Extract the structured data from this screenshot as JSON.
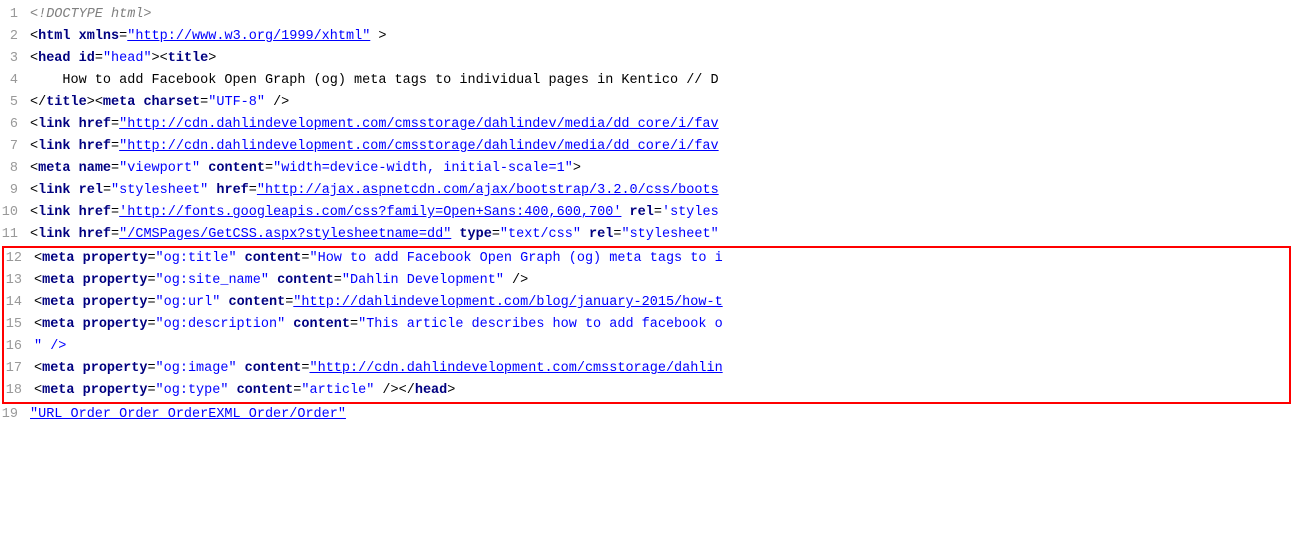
{
  "lines": [
    {
      "num": 1,
      "parts": [
        {
          "type": "comment",
          "text": "<!DOCTYPE html>"
        }
      ]
    },
    {
      "num": 2,
      "parts": [
        {
          "type": "punct",
          "text": "<"
        },
        {
          "type": "tag",
          "text": "html"
        },
        {
          "type": "punct",
          "text": " "
        },
        {
          "type": "attr-name",
          "text": "xmlns"
        },
        {
          "type": "punct",
          "text": "="
        },
        {
          "type": "attr-value",
          "text": "\"http://www.w3.org/1999/xhtml\""
        },
        {
          "type": "punct",
          "text": " >"
        }
      ]
    },
    {
      "num": 3,
      "parts": [
        {
          "type": "punct",
          "text": "<"
        },
        {
          "type": "tag",
          "text": "head"
        },
        {
          "type": "punct",
          "text": " "
        },
        {
          "type": "attr-name",
          "text": "id"
        },
        {
          "type": "punct",
          "text": "="
        },
        {
          "type": "attr-value-plain",
          "text": "\"head\""
        },
        {
          "type": "punct",
          "text": "><"
        },
        {
          "type": "tag",
          "text": "title"
        },
        {
          "type": "punct",
          "text": ">"
        }
      ]
    },
    {
      "num": 4,
      "parts": [
        {
          "type": "text-content",
          "text": "    How to add Facebook Open Graph (og) meta tags to individual pages in Kentico // D"
        }
      ]
    },
    {
      "num": 5,
      "parts": [
        {
          "type": "punct",
          "text": "</"
        },
        {
          "type": "tag",
          "text": "title"
        },
        {
          "type": "punct",
          "text": "><"
        },
        {
          "type": "tag",
          "text": "meta"
        },
        {
          "type": "punct",
          "text": " "
        },
        {
          "type": "attr-name",
          "text": "charset"
        },
        {
          "type": "punct",
          "text": "="
        },
        {
          "type": "attr-value-plain",
          "text": "\"UTF-8\""
        },
        {
          "type": "punct",
          "text": " />"
        }
      ]
    },
    {
      "num": 6,
      "parts": [
        {
          "type": "punct",
          "text": "<"
        },
        {
          "type": "tag",
          "text": "link"
        },
        {
          "type": "punct",
          "text": " "
        },
        {
          "type": "attr-name",
          "text": "href"
        },
        {
          "type": "punct",
          "text": "="
        },
        {
          "type": "attr-value",
          "text": "\"http://cdn.dahlindevelopment.com/cmsstorage/dahlindev/media/dd_core/i/fav"
        }
      ]
    },
    {
      "num": 7,
      "parts": [
        {
          "type": "punct",
          "text": "<"
        },
        {
          "type": "tag",
          "text": "link"
        },
        {
          "type": "punct",
          "text": " "
        },
        {
          "type": "attr-name",
          "text": "href"
        },
        {
          "type": "punct",
          "text": "="
        },
        {
          "type": "attr-value",
          "text": "\"http://cdn.dahlindevelopment.com/cmsstorage/dahlindev/media/dd_core/i/fav"
        }
      ]
    },
    {
      "num": 8,
      "parts": [
        {
          "type": "punct",
          "text": "<"
        },
        {
          "type": "tag",
          "text": "meta"
        },
        {
          "type": "punct",
          "text": " "
        },
        {
          "type": "attr-name",
          "text": "name"
        },
        {
          "type": "punct",
          "text": "="
        },
        {
          "type": "attr-value-plain",
          "text": "\"viewport\""
        },
        {
          "type": "punct",
          "text": " "
        },
        {
          "type": "attr-name",
          "text": "content"
        },
        {
          "type": "punct",
          "text": "="
        },
        {
          "type": "attr-value-plain",
          "text": "\"width=device-width, initial-scale=1\""
        },
        {
          "type": "punct",
          "text": ">"
        }
      ]
    },
    {
      "num": 9,
      "parts": [
        {
          "type": "punct",
          "text": "<"
        },
        {
          "type": "tag",
          "text": "link"
        },
        {
          "type": "punct",
          "text": " "
        },
        {
          "type": "attr-name",
          "text": "rel"
        },
        {
          "type": "punct",
          "text": "="
        },
        {
          "type": "attr-value-plain",
          "text": "\"stylesheet\""
        },
        {
          "type": "punct",
          "text": " "
        },
        {
          "type": "attr-name",
          "text": "href"
        },
        {
          "type": "punct",
          "text": "="
        },
        {
          "type": "attr-value",
          "text": "\"http://ajax.aspnetcdn.com/ajax/bootstrap/3.2.0/css/boots"
        }
      ]
    },
    {
      "num": 10,
      "parts": [
        {
          "type": "punct",
          "text": "<"
        },
        {
          "type": "tag",
          "text": "link"
        },
        {
          "type": "punct",
          "text": " "
        },
        {
          "type": "attr-name",
          "text": "href"
        },
        {
          "type": "punct",
          "text": "="
        },
        {
          "type": "attr-value",
          "text": "'http://fonts.googleapis.com/css?family=Open+Sans:400,600,700'"
        },
        {
          "type": "punct",
          "text": " "
        },
        {
          "type": "attr-name",
          "text": "rel"
        },
        {
          "type": "punct",
          "text": "="
        },
        {
          "type": "attr-value-plain",
          "text": "'styles"
        }
      ]
    },
    {
      "num": 11,
      "parts": [
        {
          "type": "punct",
          "text": "<"
        },
        {
          "type": "tag",
          "text": "link"
        },
        {
          "type": "punct",
          "text": " "
        },
        {
          "type": "attr-name",
          "text": "href"
        },
        {
          "type": "punct",
          "text": "="
        },
        {
          "type": "attr-value",
          "text": "\"/CMSPages/GetCSS.aspx?stylesheetname=dd\""
        },
        {
          "type": "punct",
          "text": " "
        },
        {
          "type": "attr-name",
          "text": "type"
        },
        {
          "type": "punct",
          "text": "="
        },
        {
          "type": "attr-value-plain",
          "text": "\"text/css\""
        },
        {
          "type": "punct",
          "text": " "
        },
        {
          "type": "attr-name",
          "text": "rel"
        },
        {
          "type": "punct",
          "text": "="
        },
        {
          "type": "attr-value-plain",
          "text": "\"stylesheet\""
        }
      ]
    },
    {
      "num": 12,
      "parts": [
        {
          "type": "punct",
          "text": "<"
        },
        {
          "type": "tag",
          "text": "meta"
        },
        {
          "type": "punct",
          "text": " "
        },
        {
          "type": "attr-name",
          "text": "property"
        },
        {
          "type": "punct",
          "text": "="
        },
        {
          "type": "attr-value-plain",
          "text": "\"og:title\""
        },
        {
          "type": "punct",
          "text": " "
        },
        {
          "type": "attr-name",
          "text": "content"
        },
        {
          "type": "punct",
          "text": "="
        },
        {
          "type": "attr-value-plain",
          "text": "\"How to add Facebook Open Graph (og) meta tags to i"
        }
      ],
      "highlighted": true
    },
    {
      "num": 13,
      "parts": [
        {
          "type": "punct",
          "text": "<"
        },
        {
          "type": "tag",
          "text": "meta"
        },
        {
          "type": "punct",
          "text": " "
        },
        {
          "type": "attr-name",
          "text": "property"
        },
        {
          "type": "punct",
          "text": "="
        },
        {
          "type": "attr-value-plain",
          "text": "\"og:site_name\""
        },
        {
          "type": "punct",
          "text": " "
        },
        {
          "type": "attr-name",
          "text": "content"
        },
        {
          "type": "punct",
          "text": "="
        },
        {
          "type": "attr-value-plain",
          "text": "\"Dahlin Development\""
        },
        {
          "type": "punct",
          "text": " />"
        }
      ],
      "highlighted": true
    },
    {
      "num": 14,
      "parts": [
        {
          "type": "punct",
          "text": "<"
        },
        {
          "type": "tag",
          "text": "meta"
        },
        {
          "type": "punct",
          "text": " "
        },
        {
          "type": "attr-name",
          "text": "property"
        },
        {
          "type": "punct",
          "text": "="
        },
        {
          "type": "attr-value-plain",
          "text": "\"og:url\""
        },
        {
          "type": "punct",
          "text": " "
        },
        {
          "type": "attr-name",
          "text": "content"
        },
        {
          "type": "punct",
          "text": "="
        },
        {
          "type": "attr-value",
          "text": "\"http://dahlindevelopment.com/blog/january-2015/how-t"
        }
      ],
      "highlighted": true
    },
    {
      "num": 15,
      "parts": [
        {
          "type": "punct",
          "text": "<"
        },
        {
          "type": "tag",
          "text": "meta"
        },
        {
          "type": "punct",
          "text": " "
        },
        {
          "type": "attr-name",
          "text": "property"
        },
        {
          "type": "punct",
          "text": "="
        },
        {
          "type": "attr-value-plain",
          "text": "\"og:description\""
        },
        {
          "type": "punct",
          "text": " "
        },
        {
          "type": "attr-name",
          "text": "content"
        },
        {
          "type": "punct",
          "text": "="
        },
        {
          "type": "attr-value-plain",
          "text": "\"This article describes how to add facebook o"
        }
      ],
      "highlighted": true
    },
    {
      "num": 16,
      "parts": [
        {
          "type": "attr-value-plain",
          "text": "\" />"
        }
      ],
      "highlighted": true
    },
    {
      "num": 17,
      "parts": [
        {
          "type": "punct",
          "text": "<"
        },
        {
          "type": "tag",
          "text": "meta"
        },
        {
          "type": "punct",
          "text": " "
        },
        {
          "type": "attr-name",
          "text": "property"
        },
        {
          "type": "punct",
          "text": "="
        },
        {
          "type": "attr-value-plain",
          "text": "\"og:image\""
        },
        {
          "type": "punct",
          "text": " "
        },
        {
          "type": "attr-name",
          "text": "content"
        },
        {
          "type": "punct",
          "text": "="
        },
        {
          "type": "attr-value",
          "text": "\"http://cdn.dahlindevelopment.com/cmsstorage/dahlin"
        }
      ],
      "highlighted": true
    },
    {
      "num": 18,
      "parts": [
        {
          "type": "punct",
          "text": "<"
        },
        {
          "type": "tag",
          "text": "meta"
        },
        {
          "type": "punct",
          "text": " "
        },
        {
          "type": "attr-name",
          "text": "property"
        },
        {
          "type": "punct",
          "text": "="
        },
        {
          "type": "attr-value-plain",
          "text": "\"og:type\""
        },
        {
          "type": "punct",
          "text": " "
        },
        {
          "type": "attr-name",
          "text": "content"
        },
        {
          "type": "punct",
          "text": "="
        },
        {
          "type": "attr-value-plain",
          "text": "\"article\""
        },
        {
          "type": "punct",
          "text": " /></"
        },
        {
          "type": "tag",
          "text": "head"
        },
        {
          "type": "punct",
          "text": ">"
        }
      ],
      "highlighted": true
    },
    {
      "num": 19,
      "parts": [
        {
          "type": "attr-value",
          "text": "\"URL Order Order OrderEXML Order/Order\""
        }
      ]
    }
  ]
}
